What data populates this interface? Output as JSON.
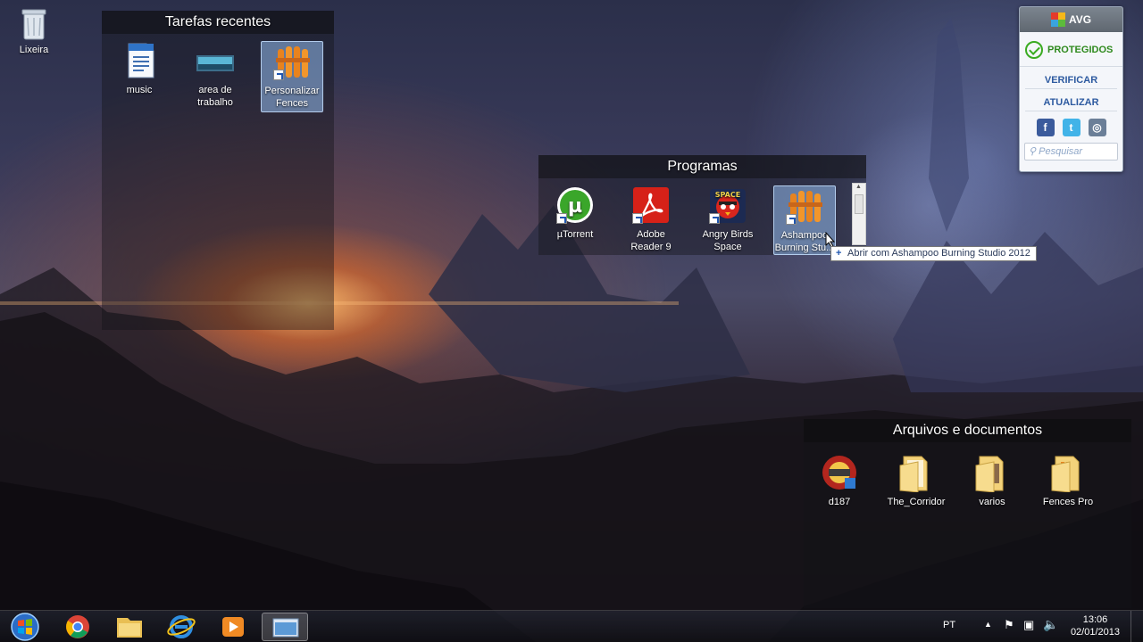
{
  "desktop": {
    "recycle_bin_label": "Lixeira"
  },
  "fences": {
    "recent": {
      "title": "Tarefas recentes",
      "items": [
        {
          "label": "music"
        },
        {
          "label": "area de trabalho"
        },
        {
          "label": "Personalizar Fences"
        }
      ]
    },
    "programs": {
      "title": "Programas",
      "items": [
        {
          "label": "µTorrent"
        },
        {
          "label": "Adobe Reader 9"
        },
        {
          "label": "Angry Birds Space"
        },
        {
          "label": "Ashampoo Burning Stu..."
        }
      ],
      "tooltip": "Abrir com Ashampoo Burning Studio 2012"
    },
    "documents": {
      "title": "Arquivos e documentos",
      "items": [
        {
          "label": "d187"
        },
        {
          "label": "The_Corridor"
        },
        {
          "label": "varios"
        },
        {
          "label": "Fences Pro"
        }
      ]
    }
  },
  "avg": {
    "brand": "AVG",
    "status": "PROTEGIDOS",
    "scan_label": "VERIFICAR",
    "update_label": "ATUALIZAR",
    "search_placeholder": "Pesquisar",
    "social": [
      "f",
      "t",
      "◎"
    ],
    "colors": {
      "status": "#2f8a1e",
      "link": "#2d5aa0"
    }
  },
  "taskbar": {
    "language": "PT",
    "time": "13:06",
    "date": "02/01/2013",
    "apps": [
      "chrome-icon",
      "explorer-icon",
      "ie-icon",
      "media-player-icon",
      "active-window-icon"
    ]
  }
}
